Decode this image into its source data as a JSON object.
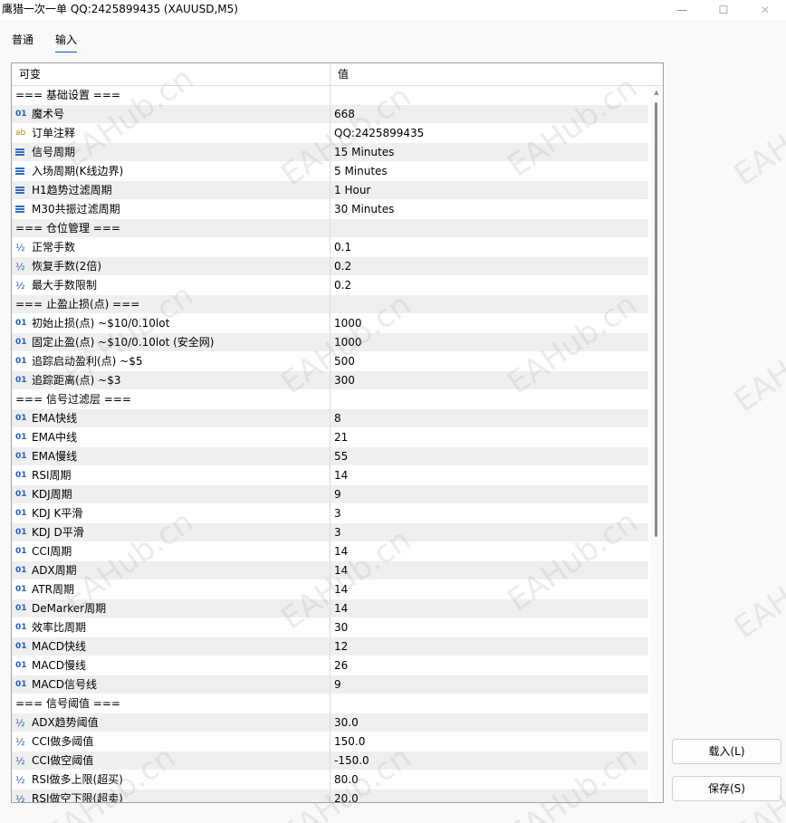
{
  "window": {
    "title": "鹰猎一次一单 QQ:2425899435 (XAUUSD,M5)",
    "minimize_glyph": "—",
    "maximize_glyph": "☐",
    "close_glyph": "✕"
  },
  "tabs": [
    {
      "label": "普通",
      "active": false
    },
    {
      "label": "输入",
      "active": true
    }
  ],
  "grid": {
    "columns": [
      "可变",
      "值"
    ],
    "rows": [
      {
        "type": "section",
        "name": "=== 基础设置 ===",
        "value": ""
      },
      {
        "type": "int",
        "icon": "01",
        "name": "魔术号",
        "value": "668"
      },
      {
        "type": "str",
        "icon": "ab",
        "name": "订单注释",
        "value": "QQ:2425899435"
      },
      {
        "type": "enum",
        "icon": "≡",
        "name": "信号周期",
        "value": "15 Minutes"
      },
      {
        "type": "enum",
        "icon": "≡",
        "name": "入场周期(K线边界)",
        "value": "5 Minutes"
      },
      {
        "type": "enum",
        "icon": "≡",
        "name": "H1趋势过滤周期",
        "value": "1 Hour"
      },
      {
        "type": "enum",
        "icon": "≡",
        "name": "M30共振过滤周期",
        "value": "30 Minutes"
      },
      {
        "type": "section",
        "name": "=== 仓位管理 ===",
        "value": ""
      },
      {
        "type": "dbl",
        "icon": "½",
        "name": "正常手数",
        "value": "0.1"
      },
      {
        "type": "dbl",
        "icon": "½",
        "name": "恢复手数(2倍)",
        "value": "0.2"
      },
      {
        "type": "dbl",
        "icon": "½",
        "name": "最大手数限制",
        "value": "0.2"
      },
      {
        "type": "section",
        "name": "=== 止盈止损(点) ===",
        "value": ""
      },
      {
        "type": "int",
        "icon": "01",
        "name": "初始止损(点) ~$10/0.10lot",
        "value": "1000"
      },
      {
        "type": "int",
        "icon": "01",
        "name": "固定止盈(点) ~$10/0.10lot (安全网)",
        "value": "1000"
      },
      {
        "type": "int",
        "icon": "01",
        "name": "追踪启动盈利(点) ~$5",
        "value": "500"
      },
      {
        "type": "int",
        "icon": "01",
        "name": "追踪距离(点) ~$3",
        "value": "300"
      },
      {
        "type": "section",
        "name": "=== 信号过滤层 ===",
        "value": ""
      },
      {
        "type": "int",
        "icon": "01",
        "name": "EMA快线",
        "value": "8"
      },
      {
        "type": "int",
        "icon": "01",
        "name": "EMA中线",
        "value": "21"
      },
      {
        "type": "int",
        "icon": "01",
        "name": "EMA慢线",
        "value": "55"
      },
      {
        "type": "int",
        "icon": "01",
        "name": "RSI周期",
        "value": "14"
      },
      {
        "type": "int",
        "icon": "01",
        "name": "KDJ周期",
        "value": "9"
      },
      {
        "type": "int",
        "icon": "01",
        "name": "KDJ K平滑",
        "value": "3"
      },
      {
        "type": "int",
        "icon": "01",
        "name": "KDJ D平滑",
        "value": "3"
      },
      {
        "type": "int",
        "icon": "01",
        "name": "CCI周期",
        "value": "14"
      },
      {
        "type": "int",
        "icon": "01",
        "name": "ADX周期",
        "value": "14"
      },
      {
        "type": "int",
        "icon": "01",
        "name": "ATR周期",
        "value": "14"
      },
      {
        "type": "int",
        "icon": "01",
        "name": "DeMarker周期",
        "value": "14"
      },
      {
        "type": "int",
        "icon": "01",
        "name": "效率比周期",
        "value": "30"
      },
      {
        "type": "int",
        "icon": "01",
        "name": "MACD快线",
        "value": "12"
      },
      {
        "type": "int",
        "icon": "01",
        "name": "MACD慢线",
        "value": "26"
      },
      {
        "type": "int",
        "icon": "01",
        "name": "MACD信号线",
        "value": "9"
      },
      {
        "type": "section",
        "name": "=== 信号阈值 ===",
        "value": ""
      },
      {
        "type": "dbl",
        "icon": "½",
        "name": "ADX趋势阈值",
        "value": "30.0"
      },
      {
        "type": "dbl",
        "icon": "½",
        "name": "CCI做多阈值",
        "value": "150.0"
      },
      {
        "type": "dbl",
        "icon": "½",
        "name": "CCI做空阈值",
        "value": "-150.0"
      },
      {
        "type": "dbl",
        "icon": "½",
        "name": "RSI做多上限(超买)",
        "value": "80.0"
      },
      {
        "type": "dbl",
        "icon": "½",
        "name": "RSI做空下限(超卖)",
        "value": "20.0"
      }
    ]
  },
  "buttons": {
    "load": "载入(L)",
    "save": "保存(S)"
  },
  "watermark_text": "EAHub.cn",
  "colors": {
    "accent": "#005fb8",
    "row_alt": "#efefef",
    "icon_blue": "#1f5fbf",
    "icon_string": "#b38600"
  }
}
